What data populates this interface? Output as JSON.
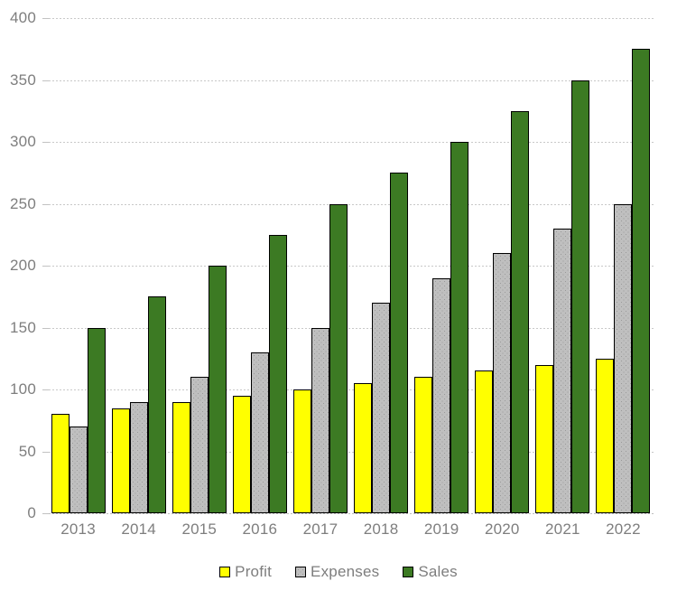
{
  "chart_data": {
    "type": "bar",
    "title": "",
    "subtitle": "",
    "xlabel": "",
    "ylabel": "",
    "categories": [
      "2013",
      "2014",
      "2015",
      "2016",
      "2017",
      "2018",
      "2019",
      "2020",
      "2021",
      "2022"
    ],
    "series": [
      {
        "name": "Profit",
        "color": "#ffff00",
        "values": [
          80,
          85,
          90,
          95,
          100,
          105,
          110,
          115,
          120,
          125
        ]
      },
      {
        "name": "Expenses",
        "color": "#bfbfbf",
        "values": [
          70,
          90,
          110,
          130,
          150,
          170,
          190,
          210,
          230,
          250
        ]
      },
      {
        "name": "Sales",
        "color": "#3c7a23",
        "values": [
          150,
          175,
          200,
          225,
          250,
          275,
          300,
          325,
          350,
          375
        ]
      }
    ],
    "ylim": [
      0,
      400
    ],
    "y_ticks": [
      0,
      50,
      100,
      150,
      200,
      250,
      300,
      350,
      400
    ],
    "y_tick_labels": [
      "0",
      "50",
      "100",
      "150",
      "200",
      "250",
      "300",
      "350",
      "400"
    ],
    "grid": true,
    "grid_axis": "y",
    "legend_position": "bottom",
    "legend_entries": [
      "Profit",
      "Expenses",
      "Sales"
    ],
    "bar_border_color": "#000000",
    "axis_label_color": "#7e7e7e",
    "gridline_color": "#c9c9c9",
    "background_color": "#ffffff"
  }
}
